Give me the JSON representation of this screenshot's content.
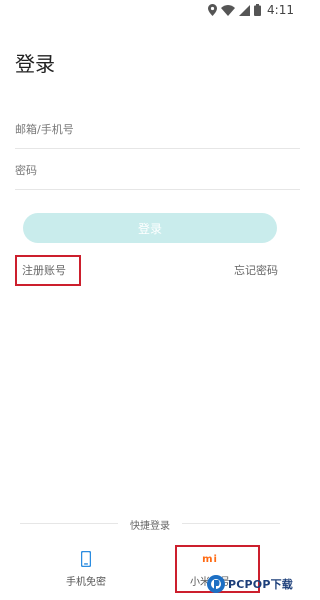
{
  "status_bar": {
    "time": "4:11",
    "icons": [
      "location-icon",
      "wifi-icon",
      "signal-icon",
      "battery-icon"
    ]
  },
  "page_title": "登录",
  "email_field": {
    "placeholder": "邮箱/手机号",
    "value": ""
  },
  "password_field": {
    "placeholder": "密码",
    "value": ""
  },
  "login_button": {
    "label": "登录",
    "color": "#c9ecec"
  },
  "register_link": "注册账号",
  "forgot_link": "忘记密码",
  "quick_login": {
    "label": "快捷登录",
    "items": [
      {
        "icon": "phone-icon",
        "label": "手机免密"
      },
      {
        "icon": "mi-logo-icon",
        "label": "小米账号",
        "logo_text": "mi"
      }
    ]
  },
  "watermark": {
    "text": "PCPOP下载"
  },
  "colors": {
    "accent_teal": "#c9ecec",
    "highlight_red": "#cc1f2d",
    "mi_orange": "#ff6a13"
  }
}
